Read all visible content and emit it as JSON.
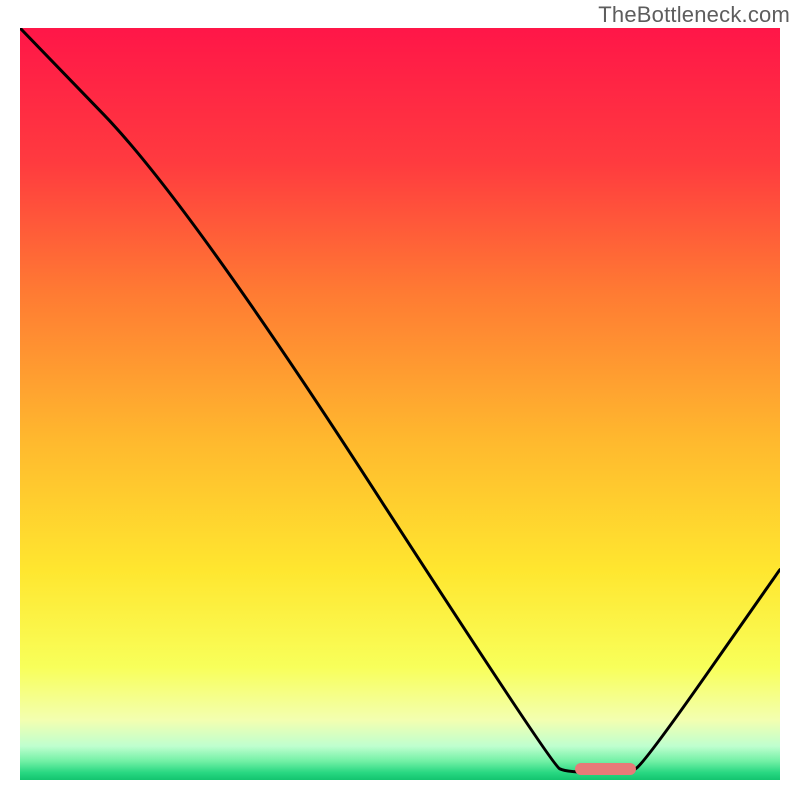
{
  "watermark": "TheBottleneck.com",
  "chart_data": {
    "type": "line",
    "title": "",
    "xlabel": "",
    "ylabel": "",
    "x_range": [
      0,
      100
    ],
    "y_range": [
      0,
      100
    ],
    "curve_points": [
      {
        "x": 0,
        "y": 100
      },
      {
        "x": 22,
        "y": 77
      },
      {
        "x": 70,
        "y": 2
      },
      {
        "x": 72,
        "y": 1
      },
      {
        "x": 80,
        "y": 1
      },
      {
        "x": 82,
        "y": 2
      },
      {
        "x": 100,
        "y": 28
      }
    ],
    "highlight_marker": {
      "x_start": 73,
      "x_end": 81,
      "y": 1.5,
      "color": "#e77a78"
    },
    "gradient_stops": [
      {
        "offset": 0,
        "color": "#ff1648"
      },
      {
        "offset": 0.18,
        "color": "#ff3b3f"
      },
      {
        "offset": 0.35,
        "color": "#ff7a33"
      },
      {
        "offset": 0.55,
        "color": "#ffb92e"
      },
      {
        "offset": 0.72,
        "color": "#ffe62f"
      },
      {
        "offset": 0.85,
        "color": "#f8ff5a"
      },
      {
        "offset": 0.92,
        "color": "#f3ffb0"
      },
      {
        "offset": 0.955,
        "color": "#bfffcf"
      },
      {
        "offset": 0.975,
        "color": "#72f0a5"
      },
      {
        "offset": 0.99,
        "color": "#29d882"
      },
      {
        "offset": 1.0,
        "color": "#13c46f"
      }
    ]
  }
}
